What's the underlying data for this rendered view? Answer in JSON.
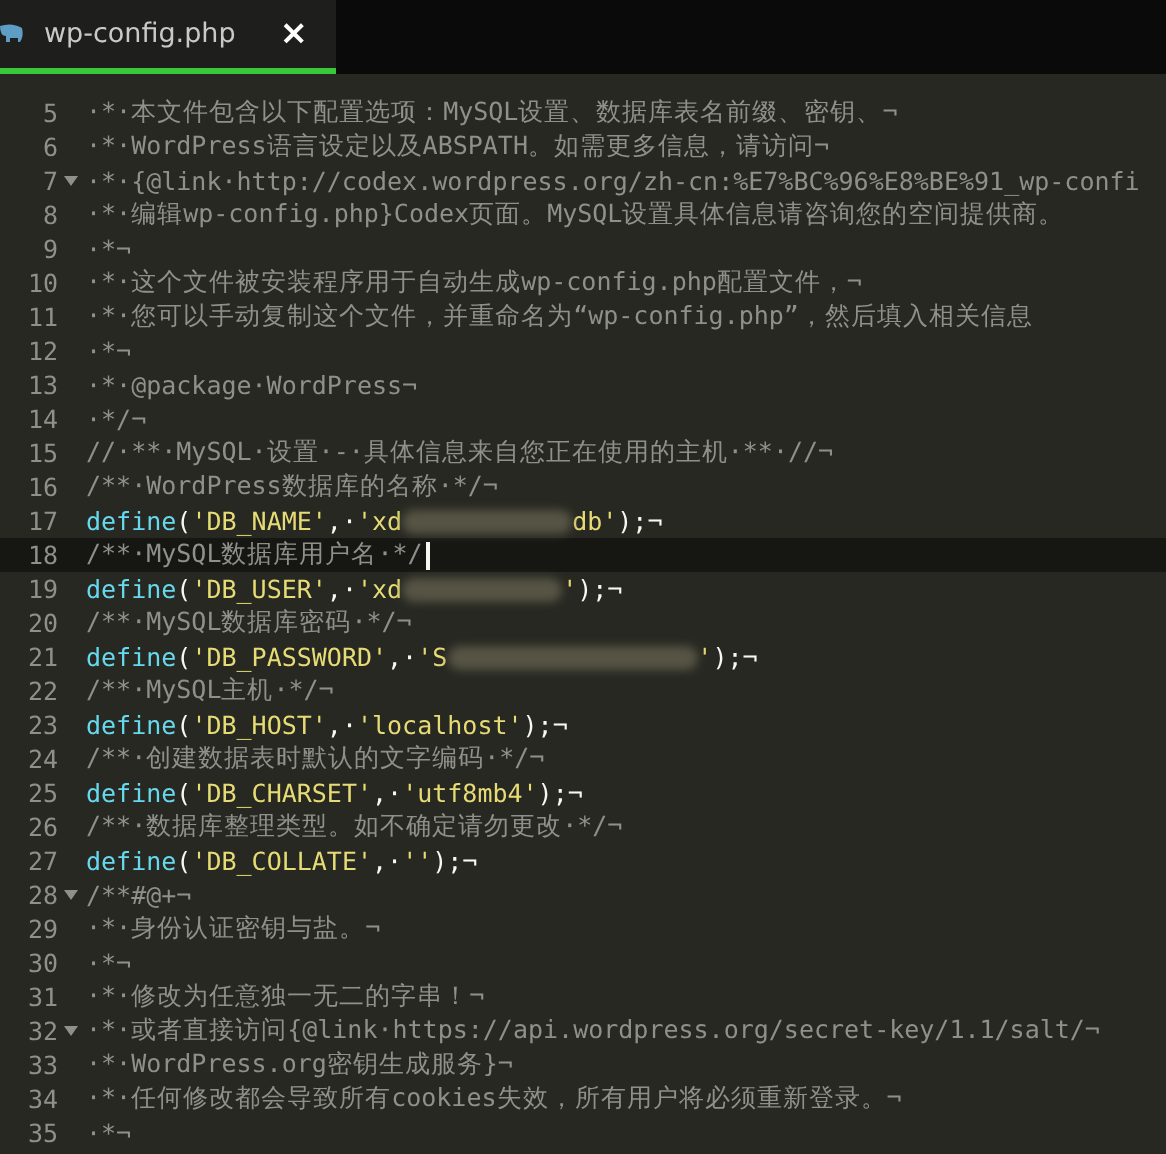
{
  "tab": {
    "title": "wp-config.php",
    "close": "×",
    "selected": true
  },
  "lines": [
    {
      "number": "5",
      "foldable": false,
      "current": false,
      "segments": [
        {
          "kind": "comment",
          "text": "·*·本文件包含以下配置选项：MySQL设置、数据库表名前缀、密钥、¬"
        }
      ]
    },
    {
      "number": "6",
      "foldable": false,
      "current": false,
      "segments": [
        {
          "kind": "comment",
          "text": "·*·WordPress语言设定以及ABSPATH。如需更多信息，请访问¬"
        }
      ]
    },
    {
      "number": "7",
      "foldable": true,
      "current": false,
      "segments": [
        {
          "kind": "comment",
          "text": "·*·{@link·http://codex.wordpress.org/zh-cn:%E7%BC%96%E8%BE%91_wp-confi"
        }
      ]
    },
    {
      "number": "8",
      "foldable": false,
      "current": false,
      "segments": [
        {
          "kind": "comment",
          "text": "·*·编辑wp-config.php}Codex页面。MySQL设置具体信息请咨询您的空间提供商。"
        }
      ]
    },
    {
      "number": "9",
      "foldable": false,
      "current": false,
      "segments": [
        {
          "kind": "comment",
          "text": "·*¬"
        }
      ]
    },
    {
      "number": "10",
      "foldable": false,
      "current": false,
      "segments": [
        {
          "kind": "comment",
          "text": "·*·这个文件被安装程序用于自动生成wp-config.php配置文件，¬"
        }
      ]
    },
    {
      "number": "11",
      "foldable": false,
      "current": false,
      "segments": [
        {
          "kind": "comment",
          "text": "·*·您可以手动复制这个文件，并重命名为“wp-config.php”，然后填入相关信息"
        }
      ]
    },
    {
      "number": "12",
      "foldable": false,
      "current": false,
      "segments": [
        {
          "kind": "comment",
          "text": "·*¬"
        }
      ]
    },
    {
      "number": "13",
      "foldable": false,
      "current": false,
      "segments": [
        {
          "kind": "comment",
          "text": "·*·@package·WordPress¬"
        }
      ]
    },
    {
      "number": "14",
      "foldable": false,
      "current": false,
      "segments": [
        {
          "kind": "comment",
          "text": "·*/¬"
        }
      ]
    },
    {
      "number": "15",
      "foldable": false,
      "current": false,
      "segments": [
        {
          "kind": "comment",
          "text": "//·**·MySQL·设置·-·具体信息来自您正在使用的主机·**·//¬"
        }
      ]
    },
    {
      "number": "16",
      "foldable": false,
      "current": false,
      "segments": [
        {
          "kind": "comment",
          "text": "/**·WordPress数据库的名称·*/¬"
        }
      ]
    },
    {
      "number": "17",
      "foldable": false,
      "current": false,
      "segments": [
        {
          "kind": "function",
          "text": "define"
        },
        {
          "kind": "punct",
          "text": "("
        },
        {
          "kind": "string",
          "text": "'DB_NAME'"
        },
        {
          "kind": "punct",
          "text": ",·"
        },
        {
          "kind": "string",
          "text": "'xd"
        },
        {
          "kind": "redacted"
        },
        {
          "kind": "string",
          "text": "db'"
        },
        {
          "kind": "punct",
          "text": ");¬"
        }
      ]
    },
    {
      "number": "18",
      "foldable": false,
      "current": true,
      "segments": [
        {
          "kind": "comment",
          "text": "/**·MySQL数据库用户名·*/"
        }
      ]
    },
    {
      "number": "19",
      "foldable": false,
      "current": false,
      "segments": [
        {
          "kind": "function",
          "text": "define"
        },
        {
          "kind": "punct",
          "text": "("
        },
        {
          "kind": "string",
          "text": "'DB_USER'"
        },
        {
          "kind": "punct",
          "text": ",·"
        },
        {
          "kind": "string",
          "text": "'xd"
        },
        {
          "kind": "redacted"
        },
        {
          "kind": "string",
          "text": "'"
        },
        {
          "kind": "punct",
          "text": ");¬"
        }
      ]
    },
    {
      "number": "20",
      "foldable": false,
      "current": false,
      "segments": [
        {
          "kind": "comment",
          "text": "/**·MySQL数据库密码·*/¬"
        }
      ]
    },
    {
      "number": "21",
      "foldable": false,
      "current": false,
      "segments": [
        {
          "kind": "function",
          "text": "define"
        },
        {
          "kind": "punct",
          "text": "("
        },
        {
          "kind": "string",
          "text": "'DB_PASSWORD'"
        },
        {
          "kind": "punct",
          "text": ",·"
        },
        {
          "kind": "string",
          "text": "'S"
        },
        {
          "kind": "redacted"
        },
        {
          "kind": "string",
          "text": "'"
        },
        {
          "kind": "punct",
          "text": ");¬"
        }
      ]
    },
    {
      "number": "22",
      "foldable": false,
      "current": false,
      "segments": [
        {
          "kind": "comment",
          "text": "/**·MySQL主机·*/¬"
        }
      ]
    },
    {
      "number": "23",
      "foldable": false,
      "current": false,
      "segments": [
        {
          "kind": "function",
          "text": "define"
        },
        {
          "kind": "punct",
          "text": "("
        },
        {
          "kind": "string",
          "text": "'DB_HOST'"
        },
        {
          "kind": "punct",
          "text": ",·"
        },
        {
          "kind": "string",
          "text": "'localhost'"
        },
        {
          "kind": "punct",
          "text": ");¬"
        }
      ]
    },
    {
      "number": "24",
      "foldable": false,
      "current": false,
      "segments": [
        {
          "kind": "comment",
          "text": "/**·创建数据表时默认的文字编码·*/¬"
        }
      ]
    },
    {
      "number": "25",
      "foldable": false,
      "current": false,
      "segments": [
        {
          "kind": "function",
          "text": "define"
        },
        {
          "kind": "punct",
          "text": "("
        },
        {
          "kind": "string",
          "text": "'DB_CHARSET'"
        },
        {
          "kind": "punct",
          "text": ",·"
        },
        {
          "kind": "string",
          "text": "'utf8mb4'"
        },
        {
          "kind": "punct",
          "text": ");¬"
        }
      ]
    },
    {
      "number": "26",
      "foldable": false,
      "current": false,
      "segments": [
        {
          "kind": "comment",
          "text": "/**·数据库整理类型。如不确定请勿更改·*/¬"
        }
      ]
    },
    {
      "number": "27",
      "foldable": false,
      "current": false,
      "segments": [
        {
          "kind": "function",
          "text": "define"
        },
        {
          "kind": "punct",
          "text": "("
        },
        {
          "kind": "string",
          "text": "'DB_COLLATE'"
        },
        {
          "kind": "punct",
          "text": ",·"
        },
        {
          "kind": "string",
          "text": "''"
        },
        {
          "kind": "punct",
          "text": ");¬"
        }
      ]
    },
    {
      "number": "28",
      "foldable": true,
      "current": false,
      "segments": [
        {
          "kind": "comment",
          "text": "/**#@+¬"
        }
      ]
    },
    {
      "number": "29",
      "foldable": false,
      "current": false,
      "segments": [
        {
          "kind": "comment",
          "text": "·*·身份认证密钥与盐。¬"
        }
      ]
    },
    {
      "number": "30",
      "foldable": false,
      "current": false,
      "segments": [
        {
          "kind": "comment",
          "text": "·*¬"
        }
      ]
    },
    {
      "number": "31",
      "foldable": false,
      "current": false,
      "segments": [
        {
          "kind": "comment",
          "text": "·*·修改为任意独一无二的字串！¬"
        }
      ]
    },
    {
      "number": "32",
      "foldable": true,
      "current": false,
      "segments": [
        {
          "kind": "comment",
          "text": "·*·或者直接访问{@link·https://api.wordpress.org/secret-key/1.1/salt/¬"
        }
      ]
    },
    {
      "number": "33",
      "foldable": false,
      "current": false,
      "segments": [
        {
          "kind": "comment",
          "text": "·*·WordPress.org密钥生成服务}¬"
        }
      ]
    },
    {
      "number": "34",
      "foldable": false,
      "current": false,
      "segments": [
        {
          "kind": "comment",
          "text": "·*·任何修改都会导致所有cookies失效，所有用户将必须重新登录。¬"
        }
      ]
    },
    {
      "number": "35",
      "foldable": false,
      "current": false,
      "segments": [
        {
          "kind": "comment",
          "text": "·*¬"
        }
      ]
    }
  ]
}
